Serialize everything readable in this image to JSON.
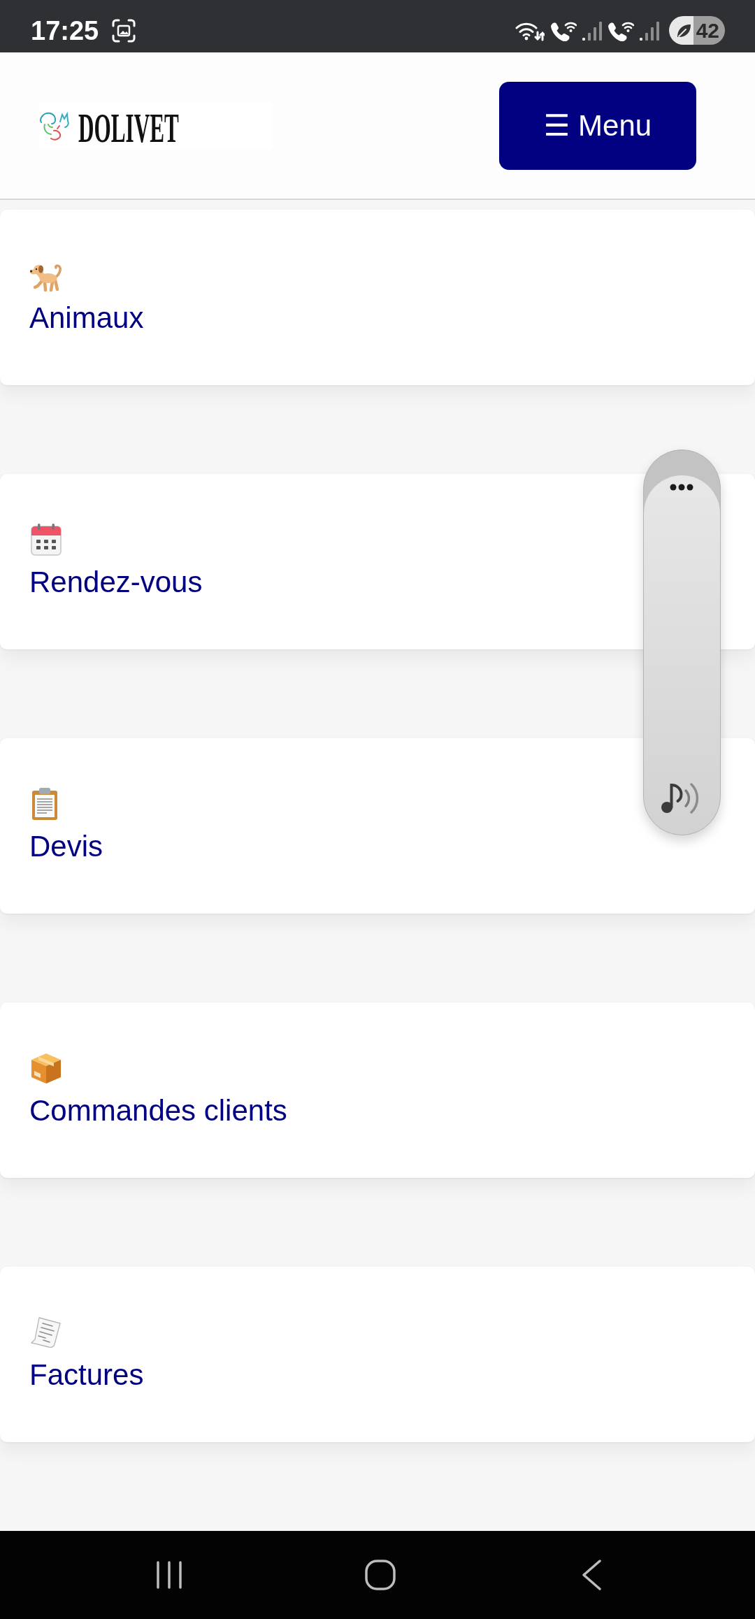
{
  "status_bar": {
    "time": "17:25",
    "battery": "42"
  },
  "header": {
    "logo_text": "DOLIVET",
    "menu_button": "☰ Menu"
  },
  "menu_cards": [
    {
      "kind": "dog",
      "label": "Animaux"
    },
    {
      "kind": "calendar",
      "label": "Rendez-vous"
    },
    {
      "kind": "clipboard",
      "label": "Devis"
    },
    {
      "kind": "package",
      "label": "Commandes clients"
    },
    {
      "kind": "receipt",
      "label": "Factures"
    }
  ]
}
